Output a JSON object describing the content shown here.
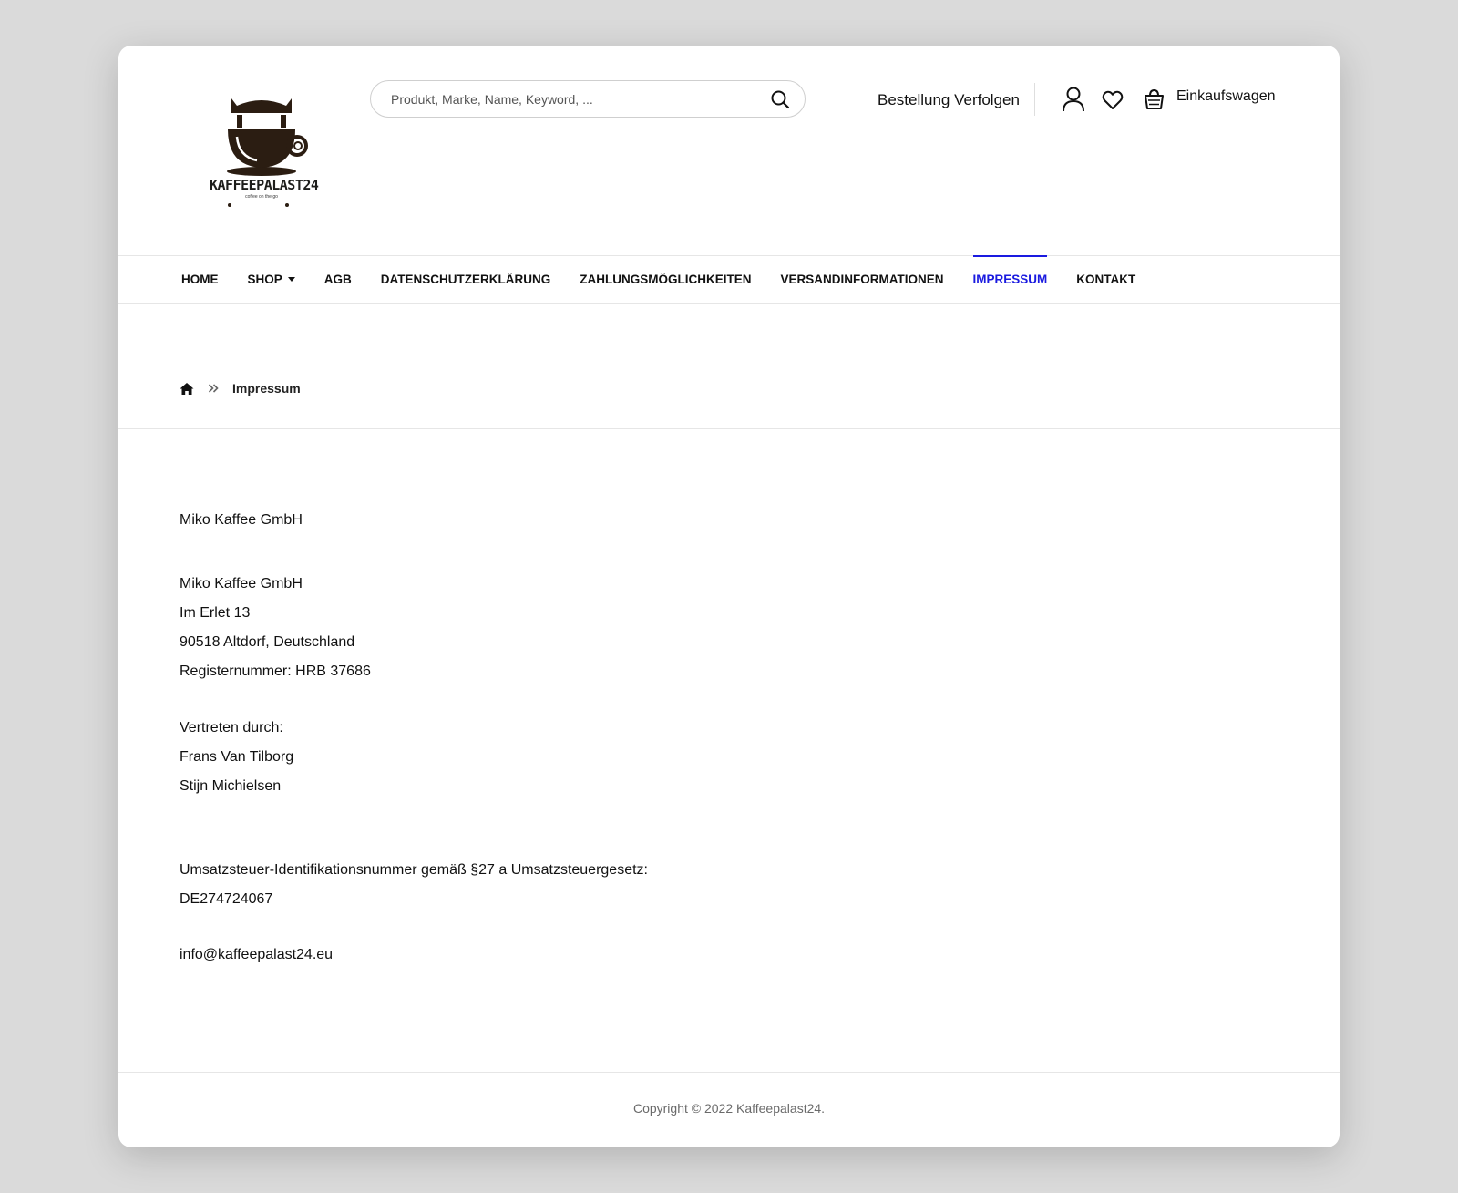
{
  "header": {
    "logo_text": "KAFFEEPALAST24",
    "logo_tagline": "coffee on the go",
    "search_placeholder": "Produkt, Marke, Name, Keyword, ...",
    "track_order": "Bestellung Verfolgen",
    "cart_label": "Einkaufswagen"
  },
  "nav": {
    "items": [
      {
        "label": "HOME"
      },
      {
        "label": "SHOP"
      },
      {
        "label": "AGB"
      },
      {
        "label": "DATENSCHUTZERKLÄRUNG"
      },
      {
        "label": "ZAHLUNGSMÖGLICHKEITEN"
      },
      {
        "label": "VERSANDINFORMATIONEN"
      },
      {
        "label": "IMPRESSUM"
      },
      {
        "label": "KONTAKT"
      }
    ],
    "active_color": "#1a1ae0"
  },
  "breadcrumb": {
    "current": "Impressum"
  },
  "content": {
    "company_heading": "Miko Kaffee GmbH",
    "address": [
      "Miko Kaffee GmbH",
      "Im Erlet 13",
      "90518 Altdorf, Deutschland",
      "Registernummer: HRB 37686"
    ],
    "represented_label": "Vertreten durch:",
    "representatives": [
      "Frans Van Tilborg",
      "Stijn Michielsen"
    ],
    "vat_label": "Umsatzsteuer-Identifikationsnummer gemäß §27 a Umsatzsteuergesetz:",
    "vat_number": "DE274724067",
    "email": "info@kaffeepalast24.eu"
  },
  "footer": {
    "copyright": "Copyright © 2022 Kaffeepalast24."
  }
}
